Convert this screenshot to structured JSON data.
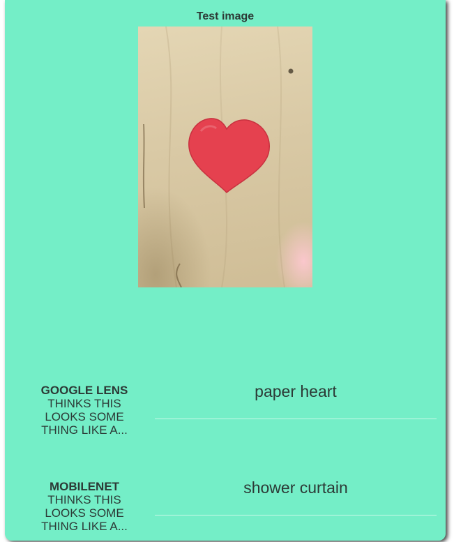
{
  "card": {
    "title": "Test image",
    "image_icon": "heart-photo"
  },
  "results": [
    {
      "source": "GOOGLE LENS",
      "caption_line1": "THINKS THIS",
      "caption_line2": "LOOKS SOME",
      "caption_line3": "THING LIKE A...",
      "prediction": "paper heart"
    },
    {
      "source": "MOBILENET",
      "caption_line1": "THINKS THIS",
      "caption_line2": "LOOKS SOME",
      "caption_line3": "THING LIKE A...",
      "prediction": "shower curtain"
    }
  ],
  "colors": {
    "card_background": "#74eec7",
    "heart": "#e5414f",
    "text": "#2c3a36"
  }
}
